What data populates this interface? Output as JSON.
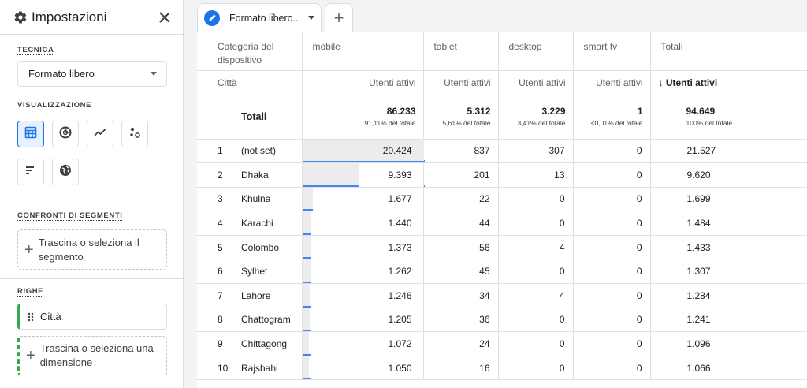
{
  "panel": {
    "title": "Impostazioni",
    "tecnica": {
      "label": "TECNICA",
      "value": "Formato libero"
    },
    "visualizzazione": {
      "label": "VISUALIZZAZIONE",
      "icons": [
        "table-icon",
        "donut-chart-icon",
        "line-chart-icon",
        "scatter-chart-icon",
        "bar-chart-icon",
        "globe-icon"
      ],
      "selected": "table-icon"
    },
    "confronti": {
      "label": "CONFRONTI DI SEGMENTI",
      "drop_text": "Trascina o seleziona il segmento"
    },
    "righe": {
      "label": "RIGHE",
      "chip": "Città",
      "drop_text": "Trascina o seleziona una dimensione"
    }
  },
  "tab": {
    "name": "Formato libero..",
    "add_label": "+"
  },
  "table": {
    "dimension_header": "Categoria del dispositivo",
    "columns": [
      "mobile",
      "tablet",
      "desktop",
      "smart tv",
      "Totali"
    ],
    "row_dimension": "Città",
    "metric": "Utenti attivi",
    "sorted_metric": "↓ Utenti attivi",
    "totals_label": "Totali",
    "totals": [
      {
        "value": "86.233",
        "pct": "91,11% del totale"
      },
      {
        "value": "5.312",
        "pct": "5,61% del totale"
      },
      {
        "value": "3.229",
        "pct": "3,41% del totale"
      },
      {
        "value": "1",
        "pct": "<0,01% del totale"
      },
      {
        "value": "94.649",
        "pct": "100% del totale"
      }
    ],
    "rows": [
      {
        "rank": "1",
        "city": "(not set)",
        "mobile": "20.424",
        "tablet": "837",
        "desktop": "307",
        "smarttv": "0",
        "total": "21.527",
        "mobile_share": 1.0
      },
      {
        "rank": "2",
        "city": "Dhaka",
        "mobile": "9.393",
        "tablet": "201",
        "desktop": "13",
        "smarttv": "0",
        "total": "9.620",
        "mobile_share": 0.46
      },
      {
        "rank": "3",
        "city": "Khulna",
        "mobile": "1.677",
        "tablet": "22",
        "desktop": "0",
        "smarttv": "0",
        "total": "1.699",
        "mobile_share": 0.082
      },
      {
        "rank": "4",
        "city": "Karachi",
        "mobile": "1.440",
        "tablet": "44",
        "desktop": "0",
        "smarttv": "0",
        "total": "1.484",
        "mobile_share": 0.071
      },
      {
        "rank": "5",
        "city": "Colombo",
        "mobile": "1.373",
        "tablet": "56",
        "desktop": "4",
        "smarttv": "0",
        "total": "1.433",
        "mobile_share": 0.067
      },
      {
        "rank": "6",
        "city": "Sylhet",
        "mobile": "1.262",
        "tablet": "45",
        "desktop": "0",
        "smarttv": "0",
        "total": "1.307",
        "mobile_share": 0.062
      },
      {
        "rank": "7",
        "city": "Lahore",
        "mobile": "1.246",
        "tablet": "34",
        "desktop": "4",
        "smarttv": "0",
        "total": "1.284",
        "mobile_share": 0.061
      },
      {
        "rank": "8",
        "city": "Chattogram",
        "mobile": "1.205",
        "tablet": "36",
        "desktop": "0",
        "smarttv": "0",
        "total": "1.241",
        "mobile_share": 0.059
      },
      {
        "rank": "9",
        "city": "Chittagong",
        "mobile": "1.072",
        "tablet": "24",
        "desktop": "0",
        "smarttv": "0",
        "total": "1.096",
        "mobile_share": 0.052
      },
      {
        "rank": "10",
        "city": "Rajshahi",
        "mobile": "1.050",
        "tablet": "16",
        "desktop": "0",
        "smarttv": "0",
        "total": "1.066",
        "mobile_share": 0.051
      }
    ]
  },
  "colors": {
    "accent": "#1a73e8",
    "bar": "#4285f4",
    "bar_fill": "#ececec",
    "chip_accent": "#34a853"
  }
}
